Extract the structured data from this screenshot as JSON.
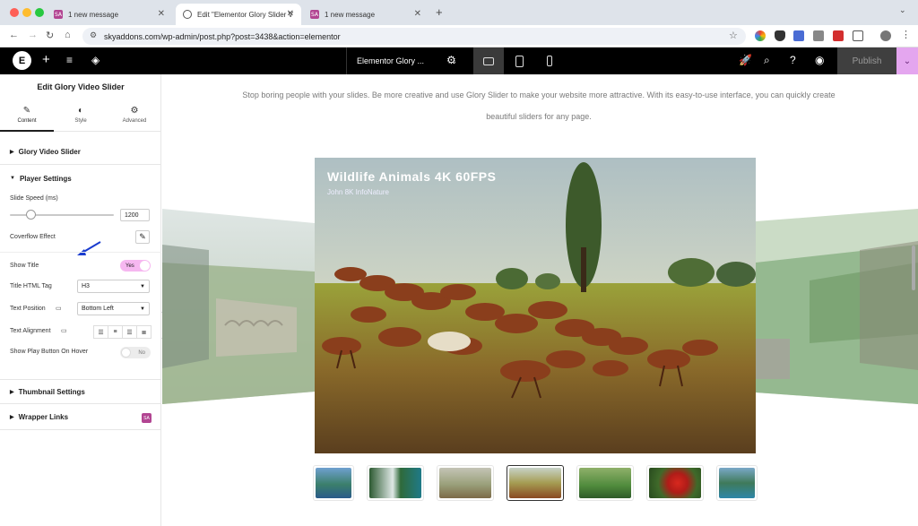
{
  "browser": {
    "tabs": [
      {
        "label": "1 new message",
        "favicon": "SA"
      },
      {
        "label": "Edit \"Elementor Glory Slider V",
        "favicon": "globe"
      },
      {
        "label": "1 new message",
        "favicon": "SA"
      }
    ],
    "url": "skyaddons.com/wp-admin/post.php?post=3438&action=elementor"
  },
  "editor_bar": {
    "document_title": "Elementor Glory ...",
    "publish_label": "Publish"
  },
  "panel": {
    "title": "Edit Glory Video Slider",
    "tabs": [
      {
        "label": "Content",
        "icon": "pencil-icon"
      },
      {
        "label": "Style",
        "icon": "contrast-icon"
      },
      {
        "label": "Advanced",
        "icon": "gear-icon"
      }
    ],
    "sections": {
      "glory": "Glory Video Slider",
      "player": "Player Settings",
      "thumbs": "Thumbnail Settings",
      "wrapper": "Wrapper Links"
    },
    "controls": {
      "slide_speed_label": "Slide Speed (ms)",
      "slide_speed_value": "1200",
      "slide_speed_fraction": 0.2,
      "coverflow_label": "Coverflow Effect",
      "show_title_label": "Show Title",
      "show_title_value": "Yes",
      "title_tag_label": "Title HTML Tag",
      "title_tag_value": "H3",
      "text_position_label": "Text Position",
      "text_position_value": "Bottom Left",
      "text_alignment_label": "Text Alignment",
      "play_button_label": "Show Play Button On Hover",
      "play_button_value": "No"
    }
  },
  "canvas": {
    "intro": "Stop boring people with your slides. Be more creative and use Glory Slider to make your website more attractive. With its easy-to-use interface, you can quickly create beautiful sliders for any page.",
    "slide_title": "Wildlife Animals 4K 60FPS",
    "slide_subtitle": "John 8K InfoNature"
  },
  "colors": {
    "accent_pink": "#f6b7f0",
    "elementor_black": "#000000",
    "skyaddons_purple": "#b24592"
  }
}
